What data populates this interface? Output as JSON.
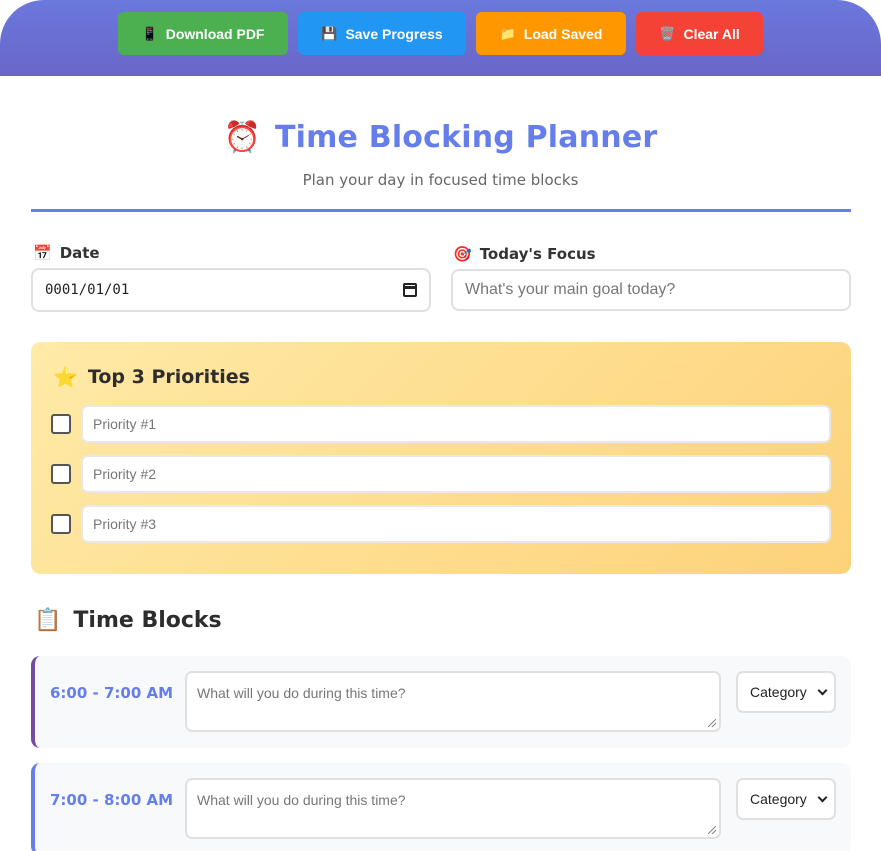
{
  "toolbar": {
    "download": {
      "icon": "📱",
      "label": "Download PDF"
    },
    "save": {
      "icon": "💾",
      "label": "Save Progress"
    },
    "load": {
      "icon": "📁",
      "label": "Load Saved"
    },
    "clear": {
      "icon": "🗑️",
      "label": "Clear All"
    }
  },
  "header": {
    "icon": "⏰",
    "title": "Time Blocking Planner",
    "subtitle": "Plan your day in focused time blocks"
  },
  "date": {
    "icon": "📅",
    "label": "Date",
    "value": "0001/01/01"
  },
  "focus": {
    "icon": "🎯",
    "label": "Today's Focus",
    "placeholder": "What's your main goal today?"
  },
  "priorities": {
    "icon": "⭐",
    "title": "Top 3 Priorities",
    "items": [
      {
        "placeholder": "Priority #1"
      },
      {
        "placeholder": "Priority #2"
      },
      {
        "placeholder": "Priority #3"
      }
    ]
  },
  "time_blocks": {
    "icon": "📋",
    "title": "Time Blocks",
    "blocks": [
      {
        "time": "6:00 - 7:00 AM",
        "placeholder": "What will you do during this time?",
        "category": "Category"
      },
      {
        "time": "7:00 - 8:00 AM",
        "placeholder": "What will you do during this time?",
        "category": "Category"
      }
    ]
  },
  "colors": {
    "accent": "#667eea",
    "accent_dark": "#764ba2",
    "download": "#4caf50",
    "save": "#2196f3",
    "load": "#ff9800",
    "clear": "#f44336"
  }
}
